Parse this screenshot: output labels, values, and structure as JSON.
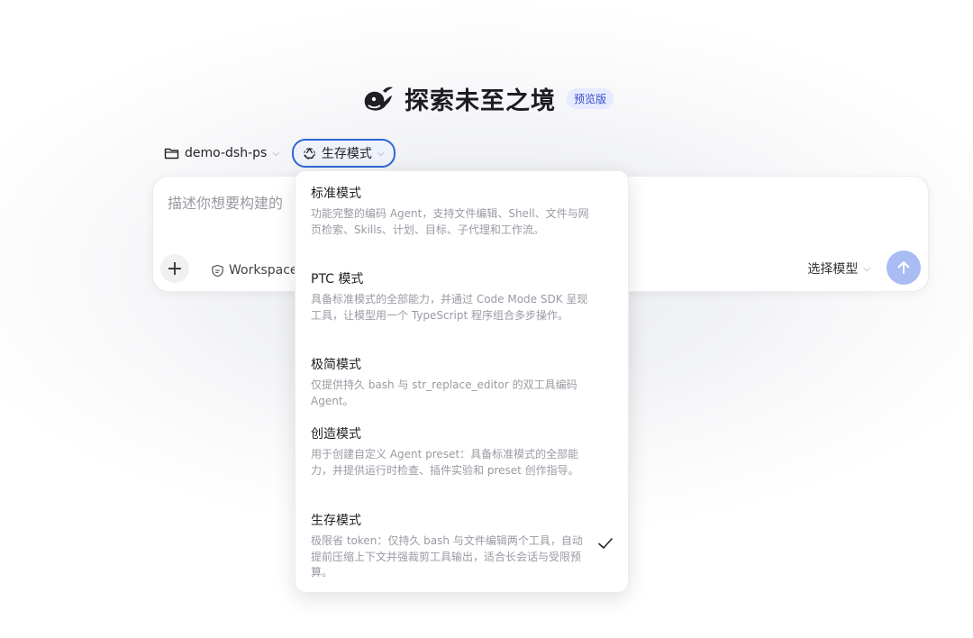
{
  "brand": {
    "title": "探索未至之境",
    "badge": "预览版"
  },
  "toolbar": {
    "workspace": "demo-dsh-ps",
    "mode": "生存模式"
  },
  "composer": {
    "placeholder": "描述你想要构建的",
    "workspace_chip": "Workspace",
    "model_select": "选择模型"
  },
  "dropdown": {
    "options": [
      {
        "title": "标准模式",
        "desc": "功能完整的编码 Agent，支持文件编辑、Shell、文件与网页检索、Skills、计划、目标、子代理和工作流。"
      },
      {
        "title": "PTC 模式",
        "desc": "具备标准模式的全部能力，并通过 Code Mode SDK 呈现工具，让模型用一个 TypeScript 程序组合多步操作。"
      },
      {
        "title": "极简模式",
        "desc": "仅提供持久 bash 与 str_replace_editor 的双工具编码 Agent。"
      },
      {
        "title": "创造模式",
        "desc": "用于创建自定义 Agent preset：具备标准模式的全部能力，并提供运行时检查、插件实验和 preset 创作指导。"
      },
      {
        "title": "生存模式",
        "desc": "极限省 token：仅持久 bash 与文件编辑两个工具，自动提前压缩上下文并强裁剪工具输出，适合长会话与受限预算。",
        "selected": true
      }
    ]
  },
  "colors": {
    "accent": "#2f66d6",
    "send_button": "#a9bdf4",
    "badge_bg": "#e6ebff"
  },
  "icons": {
    "logo": "whale-logo-icon",
    "folder": "folder-icon",
    "mode": "recycle-icon",
    "chevron": "chevron-down-icon",
    "plus": "plus-icon",
    "workspace": "shield-chat-icon",
    "send": "arrow-up-icon",
    "check": "check-icon"
  }
}
